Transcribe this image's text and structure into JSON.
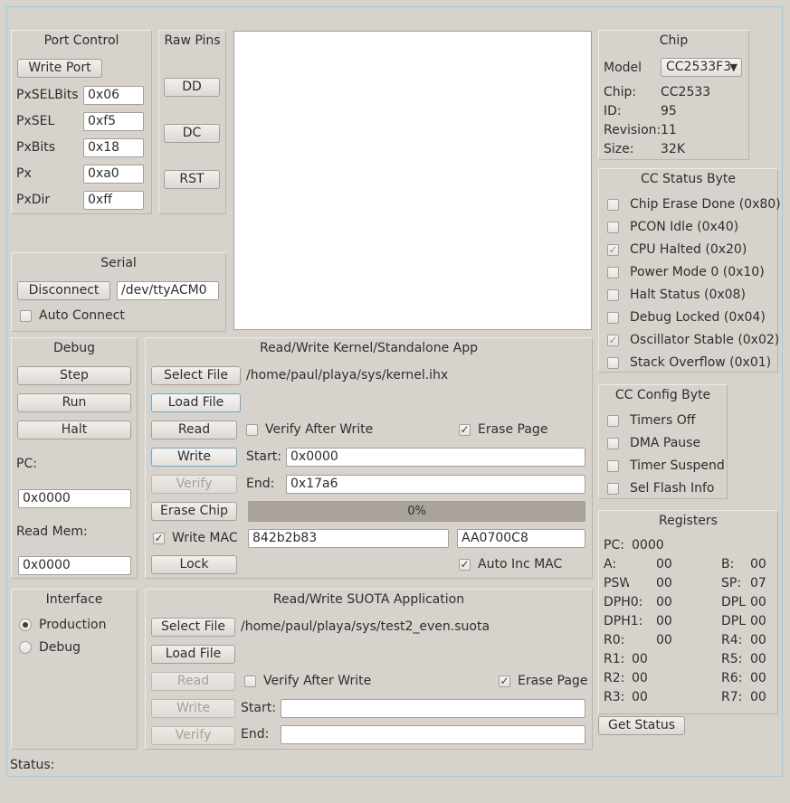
{
  "port_control": {
    "title": "Port Control",
    "write_port": "Write Port",
    "fields": [
      {
        "label": "PxSELBits",
        "value": "0x06"
      },
      {
        "label": "PxSEL",
        "value": "0xf5"
      },
      {
        "label": "PxBits",
        "value": "0x18"
      },
      {
        "label": "Px",
        "value": "0xa0"
      },
      {
        "label": "PxDir",
        "value": "0xff"
      }
    ]
  },
  "raw_pins": {
    "title": "Raw Pins",
    "dd": "DD",
    "dc": "DC",
    "rst": "RST"
  },
  "chip": {
    "title": "Chip",
    "model_label": "Model",
    "model_value": "CC2533F3",
    "chip_label": "Chip:",
    "chip_value": "CC2533",
    "id_label": "ID:",
    "id_value": "95",
    "revision_label": "Revision:",
    "revision_value": "11",
    "size_label": "Size:",
    "size_value": "32K"
  },
  "cc_status": {
    "title": "CC Status Byte",
    "items": [
      {
        "label": "Chip Erase Done (0x80)",
        "checked": false
      },
      {
        "label": "PCON Idle (0x40)",
        "checked": false
      },
      {
        "label": "CPU Halted  (0x20)",
        "checked": true
      },
      {
        "label": "Power Mode 0 (0x10)",
        "checked": false
      },
      {
        "label": "Halt Status  (0x08)",
        "checked": false
      },
      {
        "label": "Debug Locked  (0x04)",
        "checked": false
      },
      {
        "label": "Oscillator Stable (0x02)",
        "checked": true
      },
      {
        "label": "Stack Overflow  (0x01)",
        "checked": false
      }
    ]
  },
  "cc_config": {
    "title": "CC Config Byte",
    "items": [
      {
        "label": "Timers Off",
        "checked": false
      },
      {
        "label": "DMA Pause",
        "checked": false
      },
      {
        "label": "Timer Suspend",
        "checked": false
      },
      {
        "label": "Sel Flash Info",
        "checked": false
      }
    ]
  },
  "serial": {
    "title": "Serial",
    "disconnect": "Disconnect",
    "device": "/dev/ttyACM0",
    "auto_connect": "Auto Connect"
  },
  "debug": {
    "title": "Debug",
    "step": "Step",
    "run": "Run",
    "halt": "Halt",
    "pc_label": "PC:",
    "pc_value": "0x0000",
    "read_mem_label": "Read Mem:",
    "read_mem_value": "0x0000"
  },
  "kernel": {
    "title": "Read/Write Kernel/Standalone App",
    "select_file": "Select File",
    "file_path": "/home/paul/playa/sys/kernel.ihx",
    "load_file": "Load File",
    "read": "Read",
    "verify_after_write": "Verify After Write",
    "erase_page": "Erase Page",
    "write": "Write",
    "start_label": "Start:",
    "start_value": "0x0000",
    "verify": "Verify",
    "end_label": "End:",
    "end_value": "0x17a6",
    "erase_chip": "Erase Chip",
    "progress_text": "0%",
    "write_mac": "Write MAC",
    "mac_value": "842b2b83",
    "mac_value2": "AA0700C8",
    "lock": "Lock",
    "auto_inc_mac": "Auto Inc MAC"
  },
  "interface": {
    "title": "Interface",
    "production": "Production",
    "debug": "Debug"
  },
  "suota": {
    "title": "Read/Write SUOTA Application",
    "select_file": "Select File",
    "file_path": "/home/paul/playa/sys/test2_even.suota",
    "load_file": "Load File",
    "read": "Read",
    "verify_after_write": "Verify After Write",
    "erase_page": "Erase Page",
    "write": "Write",
    "start_label": "Start:",
    "start_value": "",
    "verify": "Verify",
    "end_label": "End:",
    "end_value": ""
  },
  "registers": {
    "title": "Registers",
    "pc_label": "PC:",
    "pc_value": "0000",
    "left": [
      {
        "label": "A:",
        "value": "00"
      },
      {
        "label": "PSW",
        "value": "00"
      },
      {
        "label": "DPH0:",
        "value": "00"
      },
      {
        "label": "DPH1:",
        "value": "00"
      },
      {
        "label": "R0:",
        "value": "00"
      },
      {
        "label": "R1:",
        "value": "00"
      },
      {
        "label": "R2:",
        "value": "00"
      },
      {
        "label": "R3:",
        "value": "00"
      }
    ],
    "right": [
      {
        "label": "B:",
        "value": "00"
      },
      {
        "label": "SP:",
        "value": "07"
      },
      {
        "label": "DPL",
        "value": "00"
      },
      {
        "label": "DPL",
        "value": "00"
      },
      {
        "label": "R4:",
        "value": "00"
      },
      {
        "label": "R5:",
        "value": "00"
      },
      {
        "label": "R6:",
        "value": "00"
      },
      {
        "label": "R7:",
        "value": "00"
      }
    ],
    "get_status": "Get Status"
  },
  "status_label": "Status:"
}
